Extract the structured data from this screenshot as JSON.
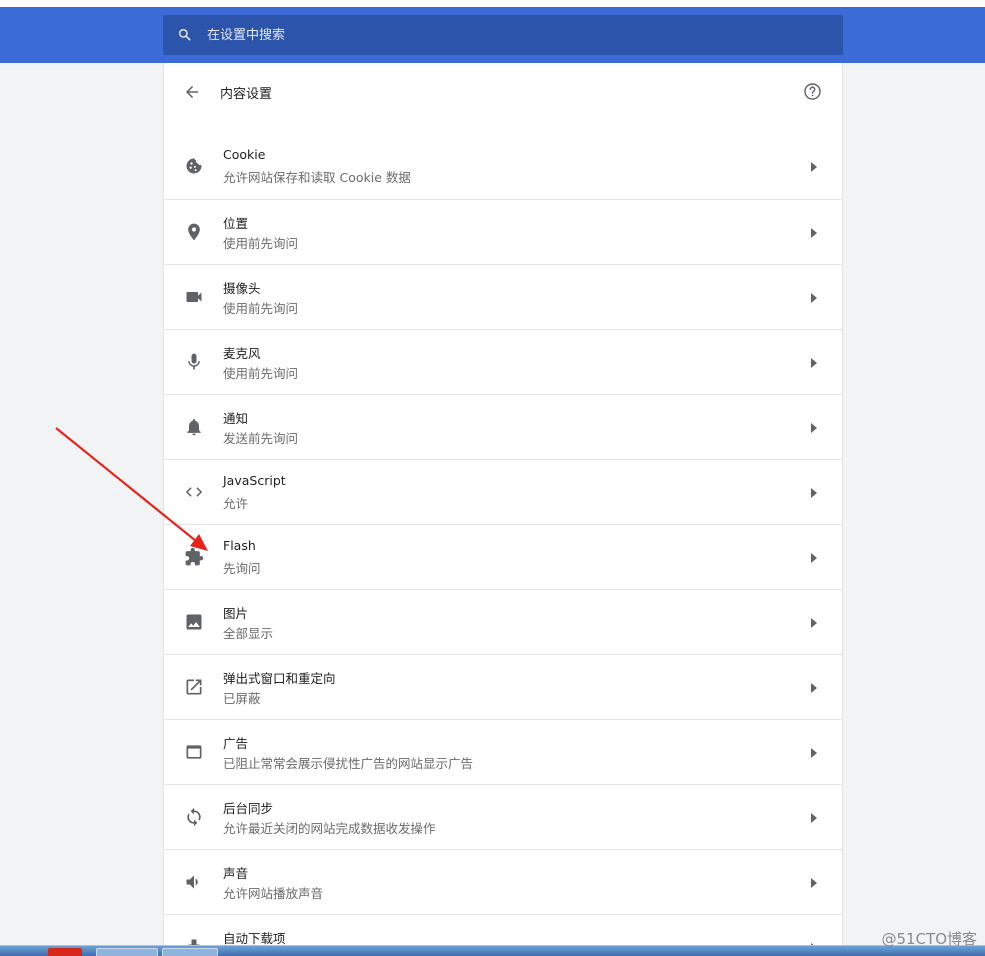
{
  "search": {
    "placeholder": "在设置中搜索"
  },
  "subpage": {
    "title": "内容设置"
  },
  "items": [
    {
      "label": "Cookie",
      "sublabel": "允许网站保存和读取 Cookie 数据",
      "icon": "cookie-icon"
    },
    {
      "label": "位置",
      "sublabel": "使用前先询问",
      "icon": "location-icon"
    },
    {
      "label": "摄像头",
      "sublabel": "使用前先询问",
      "icon": "camera-icon"
    },
    {
      "label": "麦克风",
      "sublabel": "使用前先询问",
      "icon": "microphone-icon"
    },
    {
      "label": "通知",
      "sublabel": "发送前先询问",
      "icon": "bell-icon"
    },
    {
      "label": "JavaScript",
      "sublabel": "允许",
      "icon": "code-icon"
    },
    {
      "label": "Flash",
      "sublabel": "先询问",
      "icon": "puzzle-icon"
    },
    {
      "label": "图片",
      "sublabel": "全部显示",
      "icon": "image-icon"
    },
    {
      "label": "弹出式窗口和重定向",
      "sublabel": "已屏蔽",
      "icon": "open-in-new-icon"
    },
    {
      "label": "广告",
      "sublabel": "已阻止常常会展示侵扰性广告的网站显示广告",
      "icon": "window-icon"
    },
    {
      "label": "后台同步",
      "sublabel": "允许最近关闭的网站完成数据收发操作",
      "icon": "sync-icon"
    },
    {
      "label": "声音",
      "sublabel": "允许网站播放声音",
      "icon": "volume-icon"
    },
    {
      "label": "自动下载项",
      "sublabel": "",
      "icon": "download-icon"
    }
  ],
  "watermark": "@51CTO博客",
  "colors": {
    "header": "#3a6bd6",
    "search": "#2c54ab",
    "annotation_arrow": "#e8231b",
    "icon": "#5f6368"
  }
}
